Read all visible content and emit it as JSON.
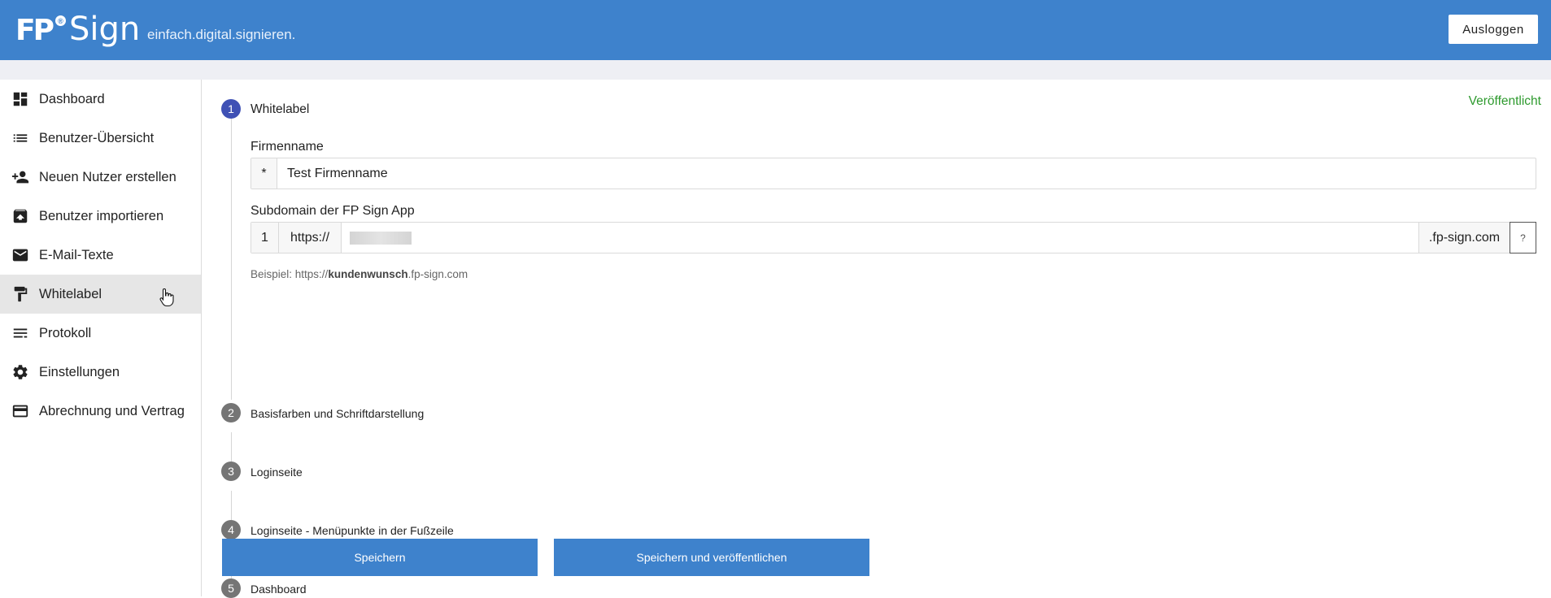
{
  "header": {
    "logo_fp": "FP",
    "logo_sign": "Sign",
    "tagline": "einfach.digital.signieren.",
    "logout_label": "Ausloggen",
    "brand_color": "#3e82cc"
  },
  "sidebar": {
    "items": [
      {
        "label": "Dashboard",
        "icon": "dashboard-icon"
      },
      {
        "label": "Benutzer-Übersicht",
        "icon": "list-icon"
      },
      {
        "label": "Neuen Nutzer erstellen",
        "icon": "person-add-icon"
      },
      {
        "label": "Benutzer importieren",
        "icon": "archive-icon"
      },
      {
        "label": "E-Mail-Texte",
        "icon": "mail-icon"
      },
      {
        "label": "Whitelabel",
        "icon": "paint-roller-icon",
        "active": true
      },
      {
        "label": "Protokoll",
        "icon": "notes-icon"
      },
      {
        "label": "Einstellungen",
        "icon": "gear-icon"
      },
      {
        "label": "Abrechnung und Vertrag",
        "icon": "credit-card-icon"
      }
    ]
  },
  "main": {
    "status": "Veröffentlicht",
    "status_color": "#2e9a2e",
    "steps": [
      {
        "number": "1",
        "title": "Whitelabel"
      },
      {
        "number": "2",
        "title": "Basisfarben und Schriftdarstellung"
      },
      {
        "number": "3",
        "title": "Loginseite"
      },
      {
        "number": "4",
        "title": "Loginseite - Menüpunkte in der Fußzeile"
      },
      {
        "number": "5",
        "title": "Dashboard"
      }
    ],
    "company": {
      "label": "Firmenname",
      "prefix": "*",
      "value": "Test Firmenname"
    },
    "subdomain": {
      "label": "Subdomain der FP Sign App",
      "index": "1",
      "protocol": "https://",
      "suffix": ".fp-sign.com",
      "help": "?",
      "hint_prefix": "Beispiel: https://",
      "hint_bold": "kundenwunsch",
      "hint_suffix": ".fp-sign.com"
    },
    "buttons": {
      "save": "Speichern",
      "save_publish": "Speichern und veröffentlichen"
    }
  }
}
